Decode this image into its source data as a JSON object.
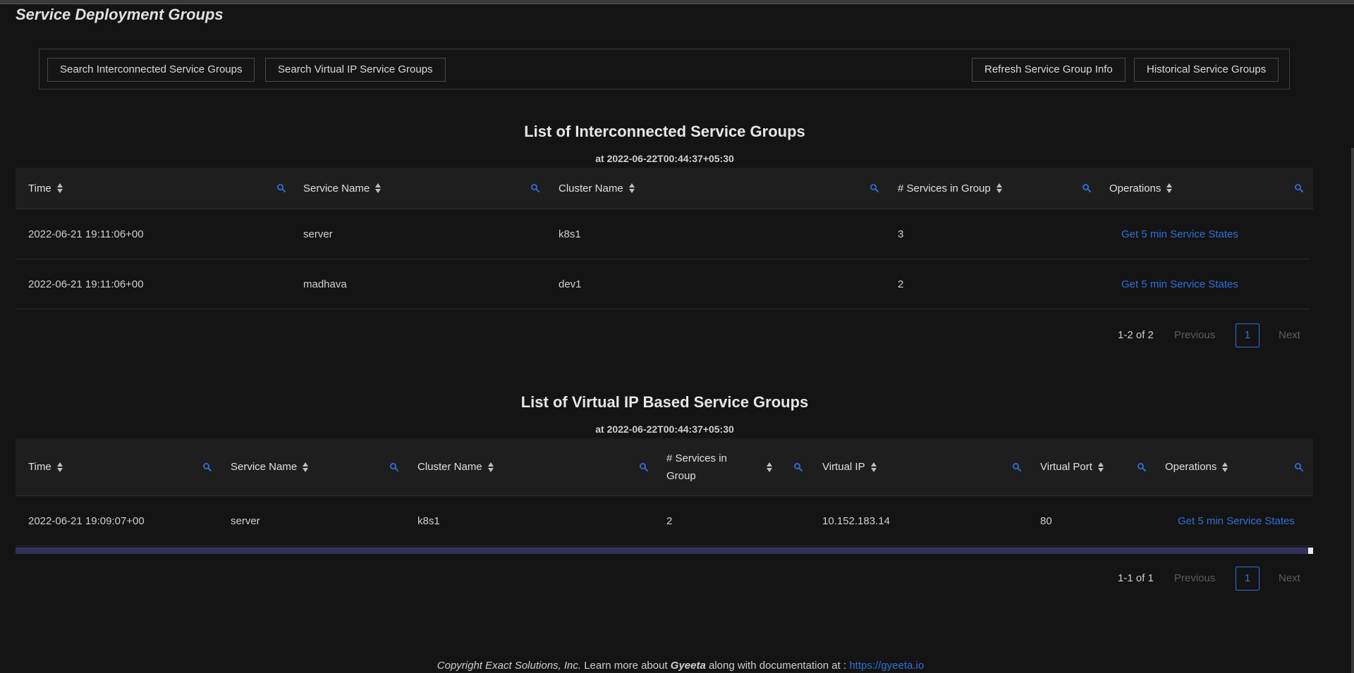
{
  "page": {
    "title": "Service Deployment Groups"
  },
  "toolbar": {
    "search_interconnected": "Search Interconnected Service Groups",
    "search_vip": "Search Virtual IP Service Groups",
    "refresh": "Refresh Service Group Info",
    "historical": "Historical Service Groups"
  },
  "interconnected": {
    "title": "List of Interconnected Service Groups",
    "subtitle": "at 2022-06-22T00:44:37+05:30",
    "columns": [
      "Time",
      "Service Name",
      "Cluster Name",
      "# Services in Group",
      "Operations"
    ],
    "rows": [
      [
        "2022-06-21 19:11:06+00",
        "server",
        "k8s1",
        "3",
        "Get 5 min Service States"
      ],
      [
        "2022-06-21 19:11:06+00",
        "madhava",
        "dev1",
        "2",
        "Get 5 min Service States"
      ]
    ],
    "pager": {
      "info": "1-2 of 2",
      "previous": "Previous",
      "page": "1",
      "next": "Next"
    }
  },
  "vip": {
    "title": "List of Virtual IP Based Service Groups",
    "subtitle": "at 2022-06-22T00:44:37+05:30",
    "columns": [
      "Time",
      "Service Name",
      "Cluster Name",
      "# Services in Group",
      "Virtual IP",
      "Virtual Port",
      "Operations"
    ],
    "rows": [
      [
        "2022-06-21 19:09:07+00",
        "server",
        "k8s1",
        "2",
        "10.152.183.14",
        "80",
        "Get 5 min Service States"
      ]
    ],
    "pager": {
      "info": "1-1 of 1",
      "previous": "Previous",
      "page": "1",
      "next": "Next"
    }
  },
  "footer": {
    "copyright": "Copyright Exact Solutions, Inc.",
    "learn": " Learn more about ",
    "brand": "Gyeeta",
    "docs": " along with documentation at : ",
    "url": "https://gyeeta.io"
  },
  "colors": {
    "accent": "#2f6fd6",
    "background": "#141414",
    "header_bg": "#1e1e1e"
  },
  "icons": {
    "column_filter": "search-icon",
    "sort": "sort-icon"
  }
}
